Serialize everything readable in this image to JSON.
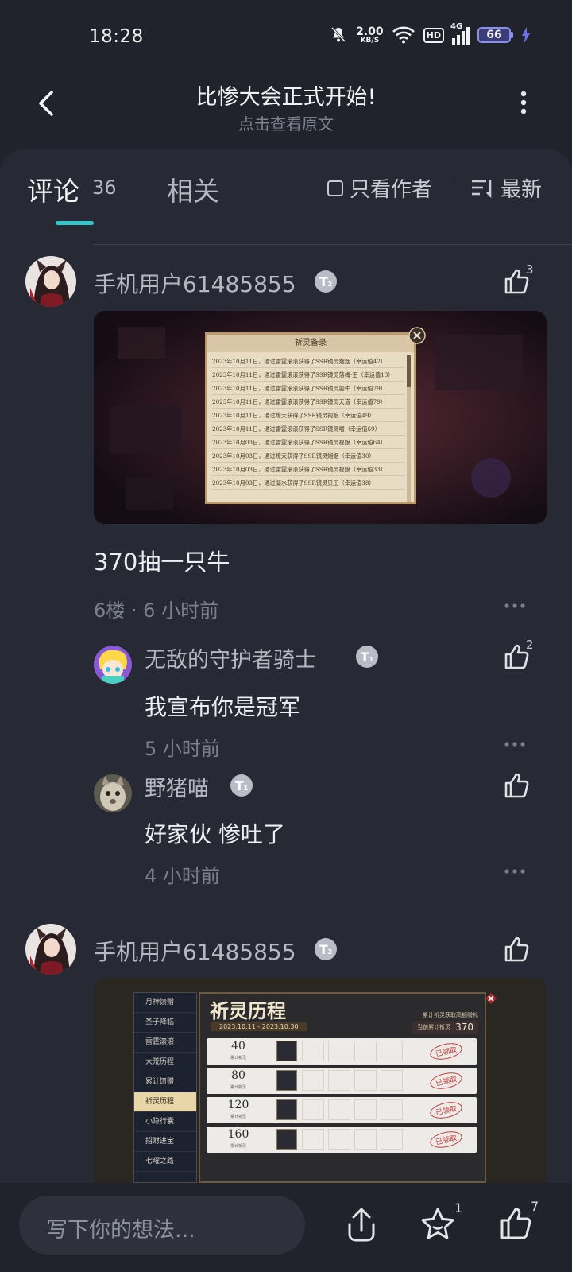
{
  "status": {
    "time": "18:28",
    "net_speed": "2.00",
    "net_unit": "KB/S",
    "hd": "HD",
    "net_type": "4G",
    "battery": "66"
  },
  "header": {
    "title": "比惨大会正式开始!",
    "subtitle": "点击查看原文"
  },
  "tabs": {
    "comments_label": "评论",
    "comments_count": "36",
    "related_label": "相关",
    "author_only": "只看作者",
    "sort_label": "最新"
  },
  "comments": [
    {
      "user": "手机用户61485855",
      "likes": "3",
      "text": "370抽一只牛",
      "floor": "6楼",
      "time": "· 6 小时前",
      "image": {
        "panel_title": "祈灵备录",
        "records": [
          "2023年10月11日，通过雷霆滚滚获得了SSR镜灵烟烟（幸运值42）",
          "2023年10月11日，通过雷霆滚滚获得了SSR镜灵落梅·王（幸运值13）",
          "2023年10月11日，通过雷霆滚滚获得了SSR镜灵鎏牛（幸运值79）",
          "2023年10月11日，通过雷霆滚滚获得了SSR镜灵天道（幸运值79）",
          "2023年10月11日，通过燎天获得了SSR镜灵视娘（幸运值49）",
          "2023年10月11日，通过雷霆滚滚获得了SSR镜灵嗜（幸运值69）",
          "2023年10月03日，通过雷霆滚滚获得了SSR镜灵视娘（幸运值64）",
          "2023年10月03日，通过燎天获得了SSR镜灵烟烟（幸运值30）",
          "2023年10月03日，通过雷霆滚滚获得了SSR镜灵视娘（幸运值33）",
          "2023年10月03日，通过凝水获得了SSR镜灵贝工（幸运值38）"
        ]
      }
    },
    {
      "user": "无敌的守护者骑士",
      "likes": "2",
      "text": "我宣布你是冠军",
      "time": "5 小时前"
    },
    {
      "user": "野猪喵",
      "likes": "",
      "text": "好家伙 惨吐了",
      "time": "4 小时前"
    },
    {
      "user": "手机用户61485855",
      "likes": "",
      "image": {
        "title": "祈灵历程",
        "date_range": "2023.10.11 - 2023.10.30",
        "total_label": "当前累计祈灵",
        "total_value": "370",
        "reward_note": "累计祈灵获取高额赠礼",
        "menu": [
          "月神馈赠",
          "圣子降临",
          "雷霆滚滚",
          "大荒历程",
          "累计馈赠",
          "祈灵历程",
          "小隐行囊",
          "招财进宝",
          "七曜之路"
        ],
        "milestones": [
          {
            "value": "40",
            "label": "累计祈灵",
            "stamp": "已领取"
          },
          {
            "value": "80",
            "label": "累计祈灵",
            "stamp": "已领取"
          },
          {
            "value": "120",
            "label": "累计祈灵",
            "stamp": "已领取"
          },
          {
            "value": "160",
            "label": "累计祈灵",
            "stamp": "已领取"
          }
        ]
      }
    }
  ],
  "bottom": {
    "compose_placeholder": "写下你的想法...",
    "star_count": "1",
    "like_count": "7"
  }
}
